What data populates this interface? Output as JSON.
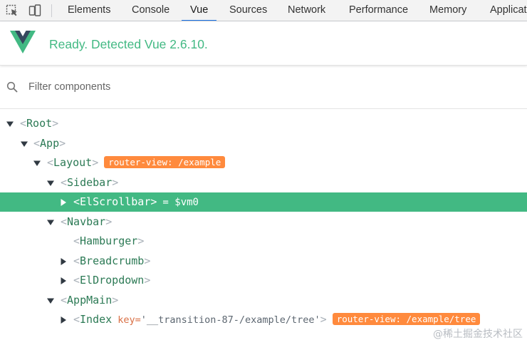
{
  "devtools": {
    "icons": [
      "inspect-icon",
      "device-toolbar-icon"
    ],
    "tabs": [
      {
        "label": "Elements",
        "active": false
      },
      {
        "label": "Console",
        "active": false
      },
      {
        "label": "Vue",
        "active": true
      },
      {
        "label": "Sources",
        "active": false
      },
      {
        "label": "Network",
        "active": false
      },
      {
        "label": "Performance",
        "active": false
      },
      {
        "label": "Memory",
        "active": false
      },
      {
        "label": "Applicat",
        "active": false
      }
    ]
  },
  "vue": {
    "status": "Ready. Detected Vue 2.6.10.",
    "brand_colors": {
      "green": "#42b983",
      "dark": "#35495e"
    }
  },
  "filter": {
    "placeholder": "Filter components",
    "value": ""
  },
  "tree": {
    "open_bracket": "<",
    "close_bracket": ">",
    "nodes": [
      {
        "name": "Root",
        "toggle": "expanded"
      },
      {
        "name": "App",
        "toggle": "expanded"
      },
      {
        "name": "Layout",
        "toggle": "expanded",
        "badge": "router-view: /example"
      },
      {
        "name": "Sidebar",
        "toggle": "expanded"
      },
      {
        "name": "ElScrollbar",
        "toggle": "collapsed",
        "selected": true,
        "vm": "= $vm0"
      },
      {
        "name": "Navbar",
        "toggle": "expanded"
      },
      {
        "name": "Hamburger",
        "toggle": "none"
      },
      {
        "name": "Breadcrumb",
        "toggle": "collapsed"
      },
      {
        "name": "ElDropdown",
        "toggle": "collapsed"
      },
      {
        "name": "AppMain",
        "toggle": "expanded"
      },
      {
        "name": "Index",
        "toggle": "collapsed",
        "attr_key": "key=",
        "attr_value": "'__transition-87-/example/tree'",
        "badge": "router-view: /example/tree"
      }
    ]
  },
  "watermark": "@稀土掘金技术社区"
}
